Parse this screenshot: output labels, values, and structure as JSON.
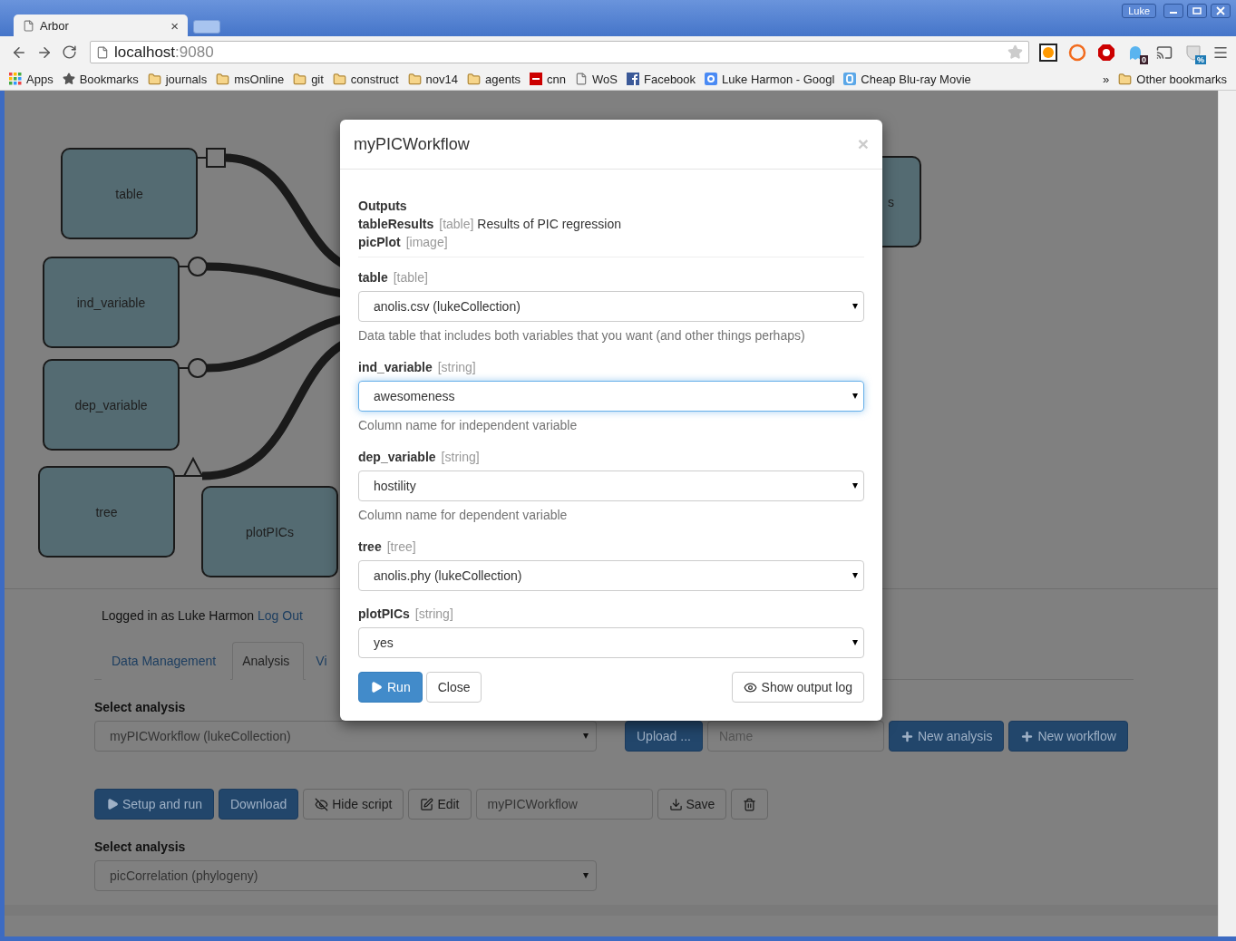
{
  "browser": {
    "tab_title": "Arbor",
    "tab_close": "×",
    "profile": "Luke",
    "url_host": "localhost",
    "url_port": ":9080",
    "bookmarks": [
      {
        "label": "Apps",
        "kind": "apps"
      },
      {
        "label": "Bookmarks",
        "kind": "star"
      },
      {
        "label": "journals",
        "kind": "folder"
      },
      {
        "label": "msOnline",
        "kind": "folder"
      },
      {
        "label": "git",
        "kind": "folder"
      },
      {
        "label": "construct",
        "kind": "folder"
      },
      {
        "label": "nov14",
        "kind": "folder"
      },
      {
        "label": "agents",
        "kind": "folder"
      },
      {
        "label": "cnn",
        "kind": "news"
      },
      {
        "label": "WoS",
        "kind": "page"
      },
      {
        "label": "Facebook",
        "kind": "facebook"
      },
      {
        "label": "Luke Harmon - Googl",
        "kind": "scholar"
      },
      {
        "label": "Cheap Blu-ray Movie",
        "kind": "blog"
      }
    ],
    "overflow": "»",
    "other_bookmarks": "Other bookmarks",
    "extension_badges": [
      "0",
      "%"
    ]
  },
  "canvas": {
    "nodes": [
      {
        "label": "table",
        "kind": "square"
      },
      {
        "label": "ind_variable",
        "kind": "circle"
      },
      {
        "label": "dep_variable",
        "kind": "circle"
      },
      {
        "label": "tree",
        "kind": "triangle"
      },
      {
        "label": "plotPICs"
      },
      {
        "label": "s"
      }
    ]
  },
  "page": {
    "login_text": "Logged in as Luke Harmon",
    "logout": "Log Out",
    "tabs": [
      {
        "label": "Data Management",
        "selected": false
      },
      {
        "label": "Analysis",
        "selected": true
      },
      {
        "label": "Vi",
        "selected": false
      }
    ],
    "select_label": "Select analysis",
    "select_value": "myPICWorkflow (lukeCollection)",
    "upload": "Upload ...",
    "name_placeholder": "Name",
    "new_analysis": "New analysis",
    "new_workflow": "New workflow",
    "setup_and_run": "Setup and run",
    "download": "Download",
    "hide_script": "Hide script",
    "edit": "Edit",
    "workflow_name": "myPICWorkflow",
    "save": "Save",
    "select_label_2": "Select analysis",
    "select_value_2": "picCorrelation (phylogeny)"
  },
  "modal": {
    "title": "myPICWorkflow",
    "close": "×",
    "outputs_heading": "Outputs",
    "outputs": [
      {
        "name": "tableResults",
        "type": "[table]",
        "description": "Results of PIC regression"
      },
      {
        "name": "picPlot",
        "type": "[image]"
      }
    ],
    "params": [
      {
        "name": "table",
        "type": "[table]",
        "value": "anolis.csv (lukeCollection)",
        "help": "Data table that includes both variables that you want (and other things perhaps)",
        "focused": false
      },
      {
        "name": "ind_variable",
        "type": "[string]",
        "value": "awesomeness",
        "help": "Column name for independent variable",
        "focused": true
      },
      {
        "name": "dep_variable",
        "type": "[string]",
        "value": "hostility",
        "help": "Column name for dependent variable",
        "focused": false
      },
      {
        "name": "tree",
        "type": "[tree]",
        "value": "anolis.phy (lukeCollection)",
        "focused": false
      },
      {
        "name": "plotPICs",
        "type": "[string]",
        "value": "yes",
        "focused": false
      }
    ],
    "run": "Run",
    "close_button": "Close",
    "show_output_log": "Show output log"
  }
}
